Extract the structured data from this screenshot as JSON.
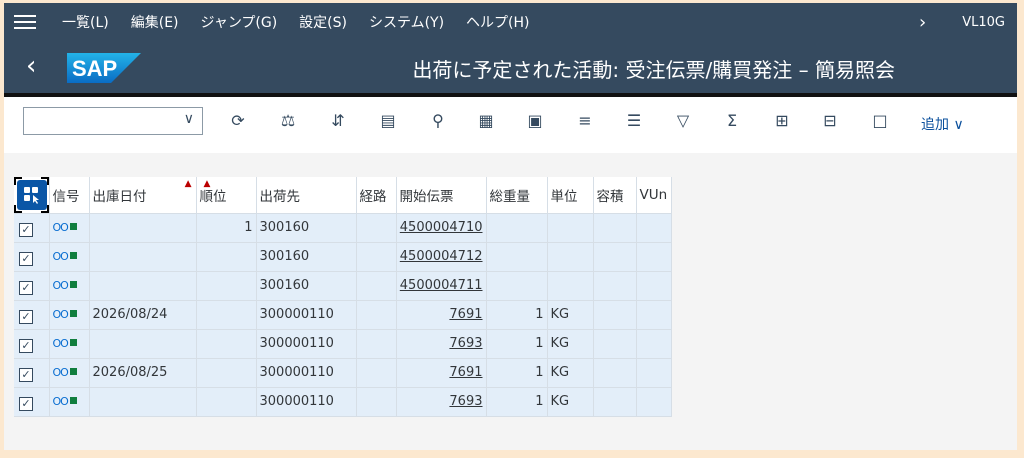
{
  "menubar": {
    "items": [
      "一覧(L)",
      "編集(E)",
      "ジャンプ(G)",
      "設定(S)",
      "システム(Y)",
      "ヘルプ(H)"
    ],
    "tcode": "VL10G"
  },
  "titlebar": {
    "logo": "SAP",
    "title": "出荷に予定された活動: 受注伝票/購買発注 – 簡易照会"
  },
  "toolbar": {
    "variant_value": "",
    "icons": [
      "refresh-icon",
      "balance-icon",
      "sort-icon",
      "document-icon",
      "zoom-icon",
      "layout-icon",
      "layout-outline-icon",
      "center-align-icon",
      "lines-icon",
      "filter-icon",
      "sum-icon",
      "add-line-icon",
      "delete-line-icon",
      "word-icon"
    ],
    "add_label": "追加"
  },
  "table": {
    "headers": [
      "信号",
      "出庫日付",
      "順位",
      "出荷先",
      "経路",
      "開始伝票",
      "総重量",
      "単位",
      "容積",
      "VUn"
    ],
    "rows": [
      {
        "checked": true,
        "date": "",
        "priority": "1",
        "ship_to": "300160",
        "route": "",
        "doc": "4500004710",
        "weight": "",
        "unit": "",
        "volume": "",
        "vun": ""
      },
      {
        "checked": true,
        "date": "",
        "priority": "",
        "ship_to": "300160",
        "route": "",
        "doc": "4500004712",
        "weight": "",
        "unit": "",
        "volume": "",
        "vun": ""
      },
      {
        "checked": true,
        "date": "",
        "priority": "",
        "ship_to": "300160",
        "route": "",
        "doc": "4500004711",
        "weight": "",
        "unit": "",
        "volume": "",
        "vun": ""
      },
      {
        "checked": true,
        "date": "2026/08/24",
        "priority": "",
        "ship_to": "300000110",
        "route": "",
        "doc": "7691",
        "weight": "1",
        "unit": "KG",
        "volume": "",
        "vun": ""
      },
      {
        "checked": true,
        "date": "",
        "priority": "",
        "ship_to": "300000110",
        "route": "",
        "doc": "7693",
        "weight": "1",
        "unit": "KG",
        "volume": "",
        "vun": ""
      },
      {
        "checked": true,
        "date": "2026/08/25",
        "priority": "",
        "ship_to": "300000110",
        "route": "",
        "doc": "7691",
        "weight": "1",
        "unit": "KG",
        "volume": "",
        "vun": ""
      },
      {
        "checked": true,
        "date": "",
        "priority": "",
        "ship_to": "300000110",
        "route": "",
        "doc": "7693",
        "weight": "1",
        "unit": "KG",
        "volume": "",
        "vun": ""
      }
    ],
    "traffic_light": "OO■"
  },
  "colors": {
    "shell": "#354a5f",
    "page_bg": "#fce8cf",
    "row_highlight": "#e3eef9",
    "link": "#0a4f9c"
  }
}
